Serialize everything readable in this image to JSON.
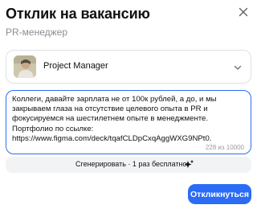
{
  "dialog": {
    "title": "Отклик на вакансию",
    "subtitle": "PR-менеджер"
  },
  "resume": {
    "selected": "Project Manager"
  },
  "cover_letter": {
    "text": "Коллеги, давайте зарплата не от 100к рублей, а до, и мы закрываем глаза на отсутствие целевого опыта в PR и фокусируемся на шестилетнем опыте в менеджменте.\nПортфолио по ссылке:\nhttps://www.figma.com/deck/tqafCLDpCxqAggWXG9NPt0.",
    "char_count": "228 из 10000"
  },
  "generate": {
    "label": "Сгенерировать · 1 раз бесплатно"
  },
  "actions": {
    "submit_label": "Откликнуться"
  },
  "colors": {
    "accent": "#2b6cf6",
    "muted_text": "#8a8d93"
  },
  "icons": {
    "close": "close-icon",
    "chevron": "chevron-down-icon",
    "sparkle": "sparkle-icon"
  }
}
